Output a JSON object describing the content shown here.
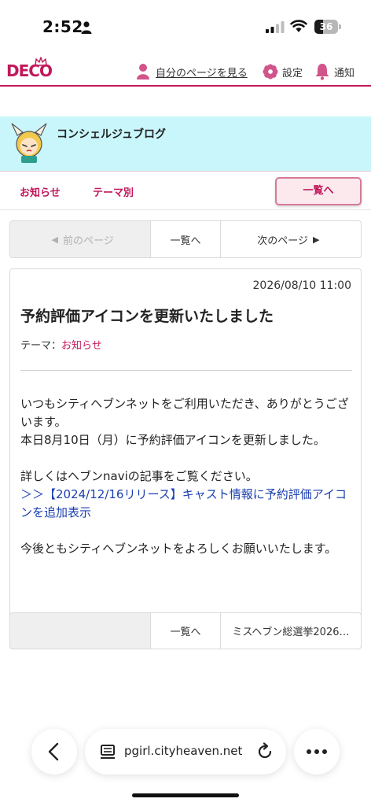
{
  "status_bar": {
    "time": "2:52",
    "battery_level": "36",
    "battery_fraction": 0.36
  },
  "header": {
    "logo_text": "DECO",
    "my_page_label": "自分のページを見る",
    "settings_label": "設定",
    "notifications_label": "通知",
    "accent_color": "#c2185b"
  },
  "blog": {
    "title": "コンシェルジュブログ",
    "banner_color": "#c9f6fb"
  },
  "nav": {
    "news_label": "お知らせ",
    "theme_label": "テーマ別",
    "list_button_label": "一覧へ"
  },
  "pager_top": {
    "prev_label": "前のページ",
    "list_label": "一覧へ",
    "next_label": "次のページ"
  },
  "post": {
    "date": "2026/08/10 11:00",
    "title": "予約評価アイコンを更新いたしました",
    "theme_prefix": "テーマ：",
    "theme_value": "お知らせ",
    "body_line1": "いつもシティヘブンネットをご利用いただき、ありがとうございます。",
    "body_line2": "本日8月10日（月）に予約評価アイコンを更新しました。",
    "body_line3": "詳しくはヘブンnaviの記事をご覧ください。",
    "body_link": "＞＞【2024/12/16リリース】キャスト情報に予約評価アイコンを追加表示",
    "body_line4": "今後ともシティヘブンネットをよろしくお願いいたします。"
  },
  "pager_bottom": {
    "prev_label": "",
    "list_label": "一覧へ",
    "next_label": "ミスヘブン総選挙2026…"
  },
  "browser": {
    "url": "pgirl.cityheaven.net"
  }
}
